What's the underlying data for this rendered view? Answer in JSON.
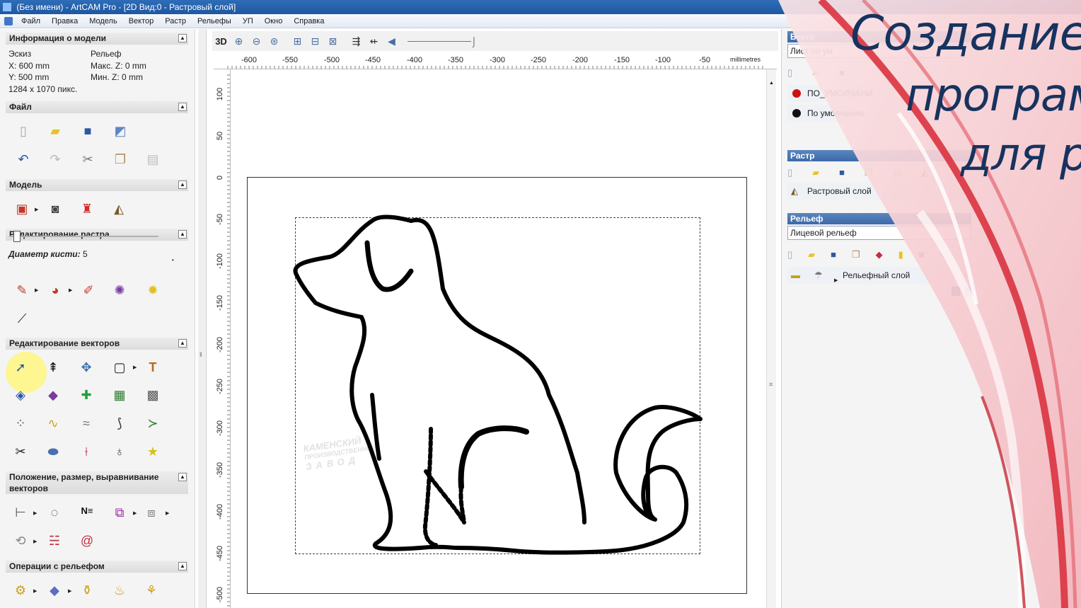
{
  "window": {
    "title": "(Без имени) - ArtCAM Pro - [2D Вид:0 - Растровый слой]"
  },
  "menu": [
    "Файл",
    "Правка",
    "Модель",
    "Вектор",
    "Растр",
    "Рельефы",
    "УП",
    "Окно",
    "Справка"
  ],
  "model_info": {
    "header": "Информация о модели",
    "sketch_label": "Эскиз",
    "sketch_x": "X: 600 mm",
    "sketch_y": "Y: 500 mm",
    "pixels": "1284 x 1070 пикс.",
    "relief_label": "Рельеф",
    "max_z": "Макс. Z: 0 mm",
    "min_z": "Мин. Z: 0 mm"
  },
  "sections": {
    "file": "Файл",
    "model": "Модель",
    "raster_edit": "Редактирование растра",
    "vector_edit": "Редактирование векторов",
    "position": "Положение, размер, выравнивание векторов",
    "relief_ops": "Операции с рельефом"
  },
  "brush": {
    "label": "Диаметр кисти:",
    "value": "5"
  },
  "view_toolbar": {
    "mode": "3D"
  },
  "ruler": {
    "units": "millimetres",
    "top_labels": [
      "-600",
      "-550",
      "-500",
      "-450",
      "-400",
      "-350",
      "-300",
      "-250",
      "-200",
      "-150",
      "-100",
      "-50"
    ],
    "left_labels": [
      "100",
      "50",
      "0",
      "-50",
      "-100",
      "-150",
      "-200",
      "-250",
      "-300",
      "-350",
      "-400",
      "-450",
      "-500"
    ]
  },
  "watermark": [
    "КАМЕНСКИЙ",
    "ПРОИЗВОДСТВЕННЫЙ",
    "ЗАВОД"
  ],
  "right_panel": {
    "vectors_header": "Векто",
    "sheet_field": "Лист по ум",
    "layer_default_red": "ПО_УМОЛЧАНИ",
    "layer_default_black": "По умолчанию",
    "raster_header": "Растр",
    "raster_layer": "Растровый слой",
    "relief_header": "Рельеф",
    "relief_field": "Лицевой рельеф",
    "relief_layer": "Рельефный слой"
  },
  "banner": {
    "line1": "Создание у",
    "line2": "програм",
    "line3": "для р"
  },
  "colors": {
    "accent_blue": "#3c6aa8",
    "banner_red": "#d9333f",
    "banner_text": "#17335f"
  }
}
